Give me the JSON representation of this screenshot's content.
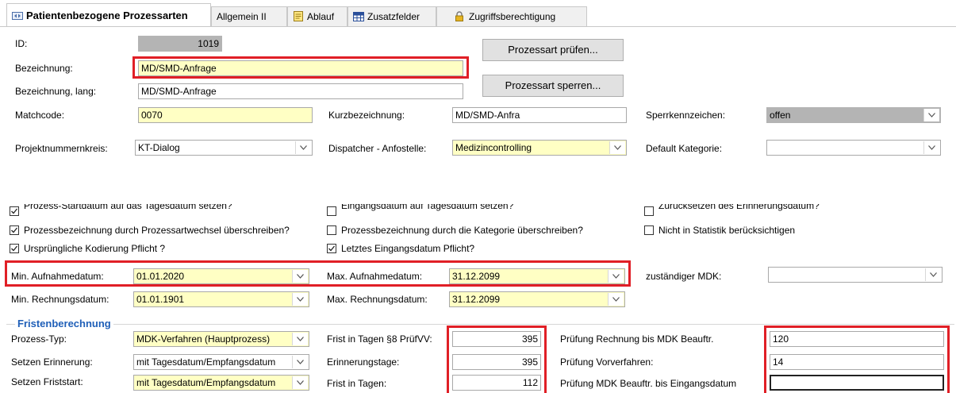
{
  "tabs": [
    {
      "label": "Patientenbezogene Prozessarten",
      "icon": "process-type-icon",
      "active": true
    },
    {
      "label": "Allgemein II",
      "icon": "",
      "active": false
    },
    {
      "label": "Ablauf",
      "icon": "notepad-icon",
      "active": false
    },
    {
      "label": "Zusatzfelder",
      "icon": "grid-icon",
      "active": false
    },
    {
      "label": "Zugriffsberechtigung",
      "icon": "lock-icon",
      "active": false
    }
  ],
  "form": {
    "id_label": "ID:",
    "id_value": "1019",
    "bezeichnung_label": "Bezeichnung:",
    "bezeichnung_value": "MD/SMD-Anfrage",
    "bezeichnung_lang_label": "Bezeichnung, lang:",
    "bezeichnung_lang_value": "MD/SMD-Anfrage",
    "matchcode_label": "Matchcode:",
    "matchcode_value": "0070",
    "kurz_label": "Kurzbezeichnung:",
    "kurz_value": "MD/SMD-Anfra",
    "sperr_label": "Sperrkennzeichen:",
    "sperr_value": "offen",
    "projekt_label": "Projektnummernkreis:",
    "projekt_value": "KT-Dialog",
    "dispatcher_label": "Dispatcher - Anfostelle:",
    "dispatcher_value": "Medizincontrolling",
    "default_kat_label": "Default Kategorie:",
    "default_kat_value": ""
  },
  "buttons": {
    "pruefen": "Prozessart prüfen...",
    "sperren": "Prozessart sperren..."
  },
  "checkboxes": [
    {
      "label": "Prozess-Startdatum auf das Tagesdatum setzen?",
      "checked": true
    },
    {
      "label": "Eingangsdatum auf Tagesdatum setzen?",
      "checked": false
    },
    {
      "label": "Zurücksetzen des Erinnerungsdatum?",
      "checked": false
    },
    {
      "label": "Prozessbezeichnung durch Prozessartwechsel überschreiben?",
      "checked": true
    },
    {
      "label": "Prozessbezeichnung durch die Kategorie überschreiben?",
      "checked": false
    },
    {
      "label": "Nicht in Statistik berücksichtigen",
      "checked": false
    },
    {
      "label": "Ursprüngliche Kodierung Pflicht ?",
      "checked": true
    },
    {
      "label": "Letztes Eingangsdatum Pflicht?",
      "checked": true
    }
  ],
  "dates": {
    "min_aufn_label": "Min. Aufnahmedatum:",
    "min_aufn_value": "01.01.2020",
    "max_aufn_label": "Max. Aufnahmedatum:",
    "max_aufn_value": "31.12.2099",
    "mdk_label": "zuständiger MDK:",
    "mdk_value": "",
    "min_rech_label": "Min. Rechnungsdatum:",
    "min_rech_value": "01.01.1901",
    "max_rech_label": "Max. Rechnungsdatum:",
    "max_rech_value": "31.12.2099"
  },
  "fristen": {
    "title": "Fristenberechnung",
    "typ_label": "Prozess-Typ:",
    "typ_value": "MDK-Verfahren (Hauptprozess)",
    "erinnerung_label": "Setzen Erinnerung:",
    "erinnerung_value": "mit Tagesdatum/Empfangsdatum",
    "fristart_label": "Setzen Friststart:",
    "fristart_value": "mit Tagesdatum/Empfangsdatum",
    "frist8_label": "Frist in Tagen §8 PrüfVV:",
    "frist8_value": "395",
    "erintage_label": "Erinnerungstage:",
    "erintage_value": "395",
    "fristtage_label": "Frist in Tagen:",
    "fristtage_value": "112",
    "pr_rech_label": "Prüfung Rechnung bis MDK Beauftr.",
    "pr_rech_value": "120",
    "pr_vor_label": "Prüfung Vorverfahren:",
    "pr_vor_value": "14",
    "pr_mdk_label": "Prüfung MDK Beauftr. bis Eingangsdatum",
    "pr_mdk_value": ""
  }
}
